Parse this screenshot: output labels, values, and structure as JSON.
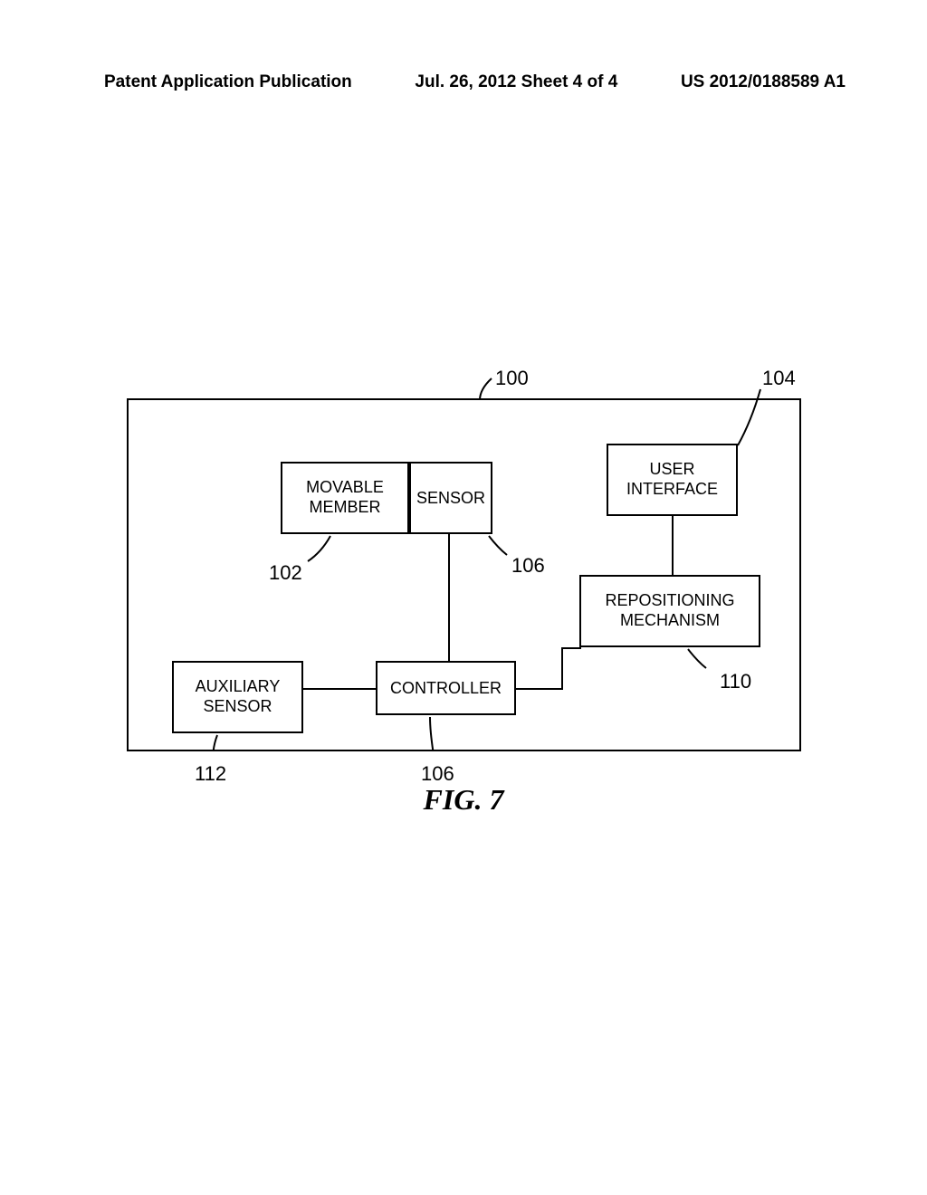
{
  "header": {
    "left": "Patent Application Publication",
    "center": "Jul. 26, 2012  Sheet 4 of 4",
    "right": "US 2012/0188589 A1"
  },
  "blocks": {
    "movable_member": "MOVABLE\nMEMBER",
    "sensor": "SENSOR",
    "user_interface": "USER\nINTERFACE",
    "repositioning": "REPOSITIONING\nMECHANISM",
    "auxiliary_sensor": "AUXILIARY\nSENSOR",
    "controller": "CONTROLLER"
  },
  "labels": {
    "ref_100": "100",
    "ref_104": "104",
    "ref_102": "102",
    "ref_106a": "106",
    "ref_106b": "106",
    "ref_110": "110",
    "ref_112": "112"
  },
  "figure": "FIG. 7"
}
